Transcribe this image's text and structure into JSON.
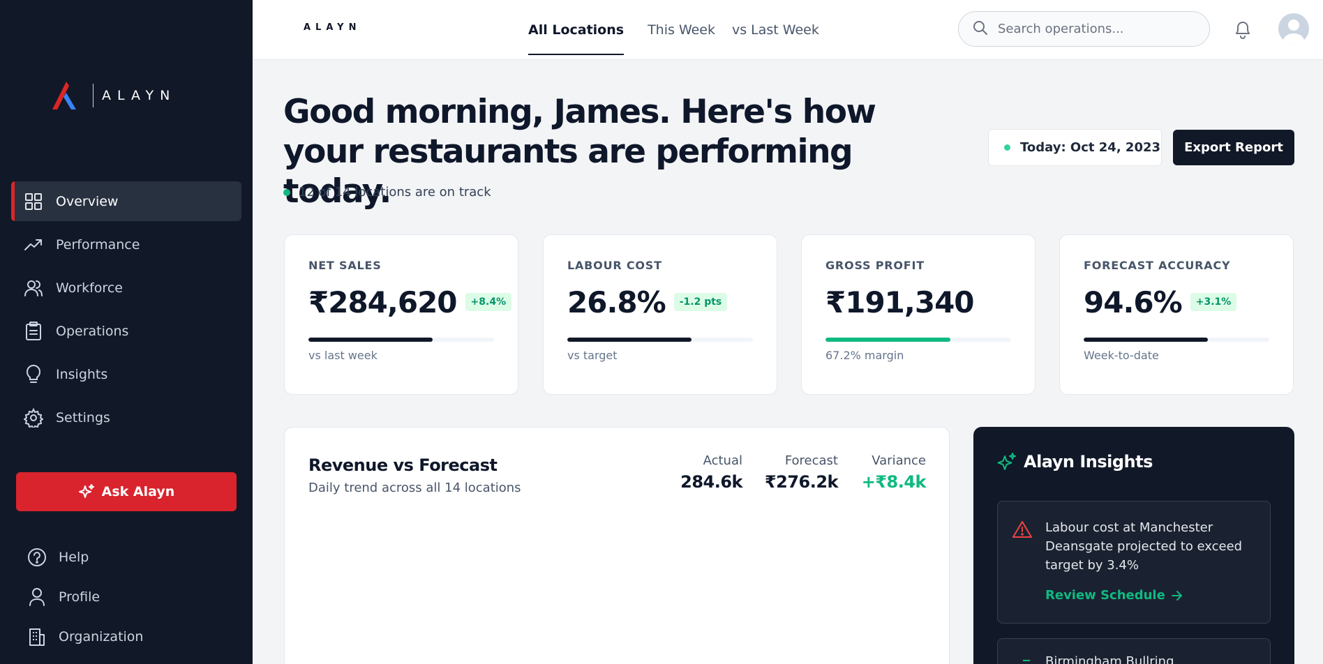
{
  "brand": {
    "name": "ALAYN",
    "accent": "#dc2626",
    "success": "#10b981"
  },
  "sidebar": {
    "nav": [
      {
        "label": "Overview",
        "icon": "grid-icon",
        "active": true
      },
      {
        "label": "Performance",
        "icon": "trending-up-icon"
      },
      {
        "label": "Workforce",
        "icon": "users-icon"
      },
      {
        "label": "Operations",
        "icon": "clipboard-icon"
      },
      {
        "label": "Insights",
        "icon": "lightbulb-icon"
      },
      {
        "label": "Settings",
        "icon": "gear-icon"
      }
    ],
    "ask_label": "Ask Alayn",
    "bottom": [
      {
        "label": "Help",
        "icon": "help-circle-icon"
      },
      {
        "label": "Profile",
        "icon": "user-icon"
      },
      {
        "label": "Organization",
        "icon": "building-icon"
      }
    ]
  },
  "topbar": {
    "logo": "ALAYN",
    "tabs": [
      {
        "label": "All Locations",
        "active": true
      },
      {
        "label": "This Week"
      },
      {
        "label": "vs Last Week"
      }
    ],
    "search_placeholder": "Search operations..."
  },
  "header": {
    "greeting": "Good morning, James. Here's how your restaurants are performing today.",
    "status": "12 of 14 locations are on track",
    "date": "Today: Oct 24, 2023",
    "export_label": "Export Report"
  },
  "kpis": [
    {
      "label": "NET SALES",
      "value": "₹284,620",
      "badge": "+8.4%",
      "progress": 0.67,
      "footnote": "vs last week",
      "bar": "dark"
    },
    {
      "label": "LABOUR COST",
      "value": "26.8%",
      "badge": "-1.2 pts",
      "progress": 0.67,
      "footnote": "vs target",
      "bar": "dark"
    },
    {
      "label": "GROSS PROFIT",
      "value": "₹191,340",
      "badge": "",
      "progress": 0.672,
      "footnote": "67.2% margin",
      "bar": "green"
    },
    {
      "label": "FORECAST ACCURACY",
      "value": "94.6%",
      "badge": "+3.1%",
      "progress": 0.67,
      "footnote": "Week-to-date",
      "bar": "dark"
    }
  ],
  "revenue": {
    "title": "Revenue vs Forecast",
    "subtitle": "Daily trend across all 14 locations",
    "actual_label": "Actual",
    "actual_value": "284.6k",
    "forecast_label": "Forecast",
    "forecast_value": "₹276.2k",
    "variance_label": "Variance",
    "variance_value": "+₹8.4k"
  },
  "insights": {
    "title": "Alayn Insights",
    "alerts": [
      {
        "message": "Labour cost at Manchester Deansgate projected to exceed target by 3.4%",
        "action": "Review Schedule"
      },
      {
        "message": "Birmingham Bullring"
      }
    ]
  }
}
